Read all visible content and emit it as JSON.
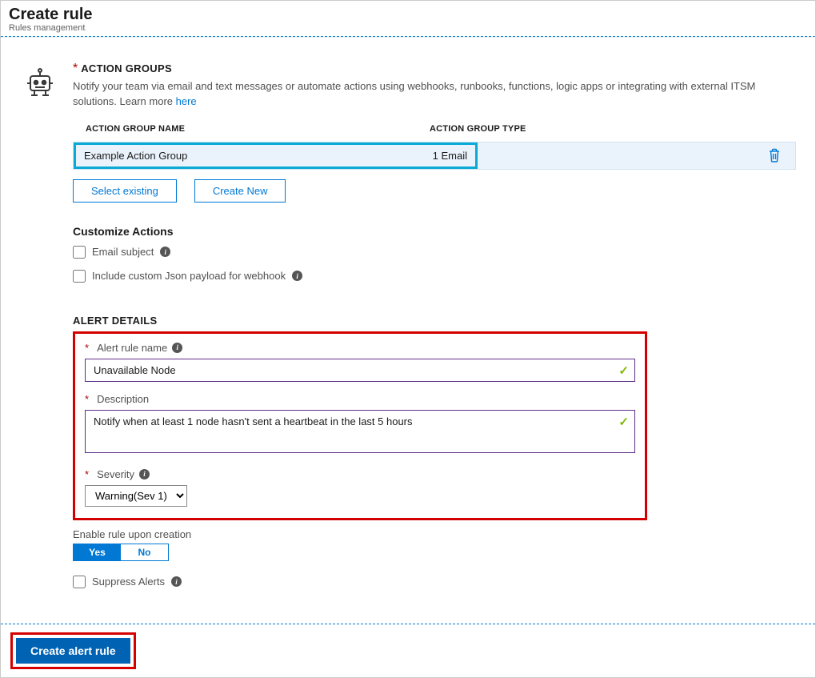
{
  "header": {
    "title": "Create rule",
    "subtitle": "Rules management"
  },
  "action_groups": {
    "section_title": "ACTION GROUPS",
    "description": "Notify your team via email and text messages or automate actions using webhooks, runbooks, functions, logic apps or integrating with external ITSM solutions. Learn more ",
    "learn_more": "here",
    "col_name": "ACTION GROUP NAME",
    "col_type": "ACTION GROUP TYPE",
    "rows": [
      {
        "name": "Example Action Group",
        "type_label": "1 Email"
      }
    ],
    "select_existing": "Select existing",
    "create_new": "Create New",
    "customize_title": "Customize Actions",
    "opt_email_subject": "Email subject",
    "opt_json_payload": "Include custom Json payload for webhook"
  },
  "alert_details": {
    "section_title": "ALERT DETAILS",
    "rule_name_label": "Alert rule name",
    "rule_name_value": "Unavailable Node",
    "description_label": "Description",
    "description_value": "Notify when at least 1 node hasn't sent a heartbeat in the last 5 hours",
    "severity_label": "Severity",
    "severity_value": "Warning(Sev 1)",
    "enable_label": "Enable rule upon creation",
    "enable_yes": "Yes",
    "enable_no": "No",
    "suppress_label": "Suppress Alerts"
  },
  "footer": {
    "create_button": "Create alert rule"
  },
  "icons": {
    "info": "i"
  }
}
